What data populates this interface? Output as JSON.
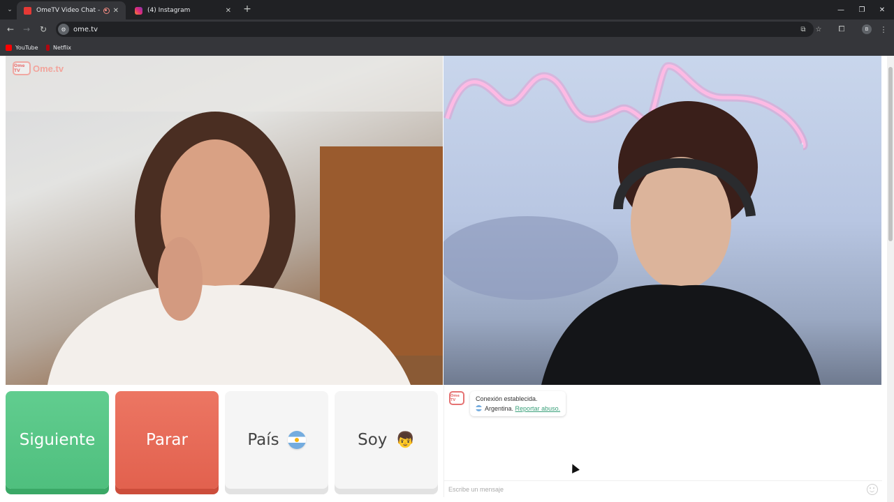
{
  "browser": {
    "tabs": [
      {
        "title": "OmeTV Video Chat — Ome",
        "active": true
      },
      {
        "title": "(4) Instagram",
        "active": false
      }
    ],
    "url": "ome.tv",
    "profile_initial": "B",
    "bookmarks": [
      {
        "label": "YouTube"
      },
      {
        "label": "Netflix"
      }
    ]
  },
  "page": {
    "logo_text": "Ome.tv",
    "logo_badge": "Ome TV",
    "buttons": {
      "next": "Siguiente",
      "stop": "Parar",
      "country": "País",
      "gender": "Soy"
    },
    "chat": {
      "status": "Conexión establecida.",
      "country": "Argentina.",
      "report_link": "Reportar abuso.",
      "placeholder": "Escribe un mensaje"
    },
    "colors": {
      "next": "#4fbf7e",
      "stop": "#e2614e",
      "link": "#3aa07a"
    }
  }
}
